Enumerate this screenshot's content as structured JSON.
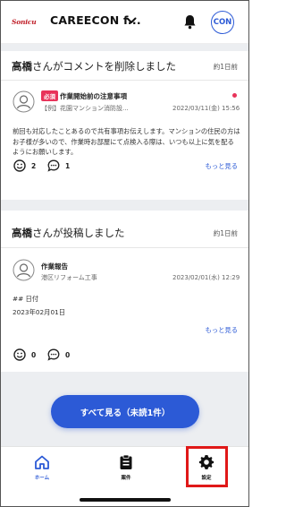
{
  "header": {
    "logo_text": "Sonicu",
    "company": "CAREECON f...",
    "avatar_text": "CON"
  },
  "feed": [
    {
      "headline_name": "高橋",
      "headline_rest": "さんがコメントを削除しました",
      "time_ago": "約1日前",
      "badge": "必須",
      "title": "作業開始前の注意事項",
      "subtitle": "【例】花園マンション消防設...",
      "date": "2022/03/11(金) 15:56",
      "body": "前回も対応したことあるので共有事項お伝えします。マンションの住民の方はお子様が多いので、作業時お部屋にて点検入る際は、いつも以上に気を配るようにお願いします。",
      "more": "もっと見る",
      "reactions": "2",
      "comments": "1"
    },
    {
      "headline_name": "高橋",
      "headline_rest": "さんが投稿しました",
      "time_ago": "約1日前",
      "title": "作業報告",
      "subtitle": "港区リフォーム工事",
      "date": "2023/02/01(水) 12:29",
      "body_line1": "## 日付",
      "body_line2": "2023年02月01日",
      "more": "もっと見る",
      "reactions": "0",
      "comments": "0"
    }
  ],
  "cta_label": "すべて見る（未読1件）",
  "nav": {
    "home": "ホーム",
    "cases": "案件",
    "settings": "設定"
  },
  "colors": {
    "accent": "#2c5ad6",
    "badge": "#e8335a",
    "highlight": "#e01818"
  }
}
